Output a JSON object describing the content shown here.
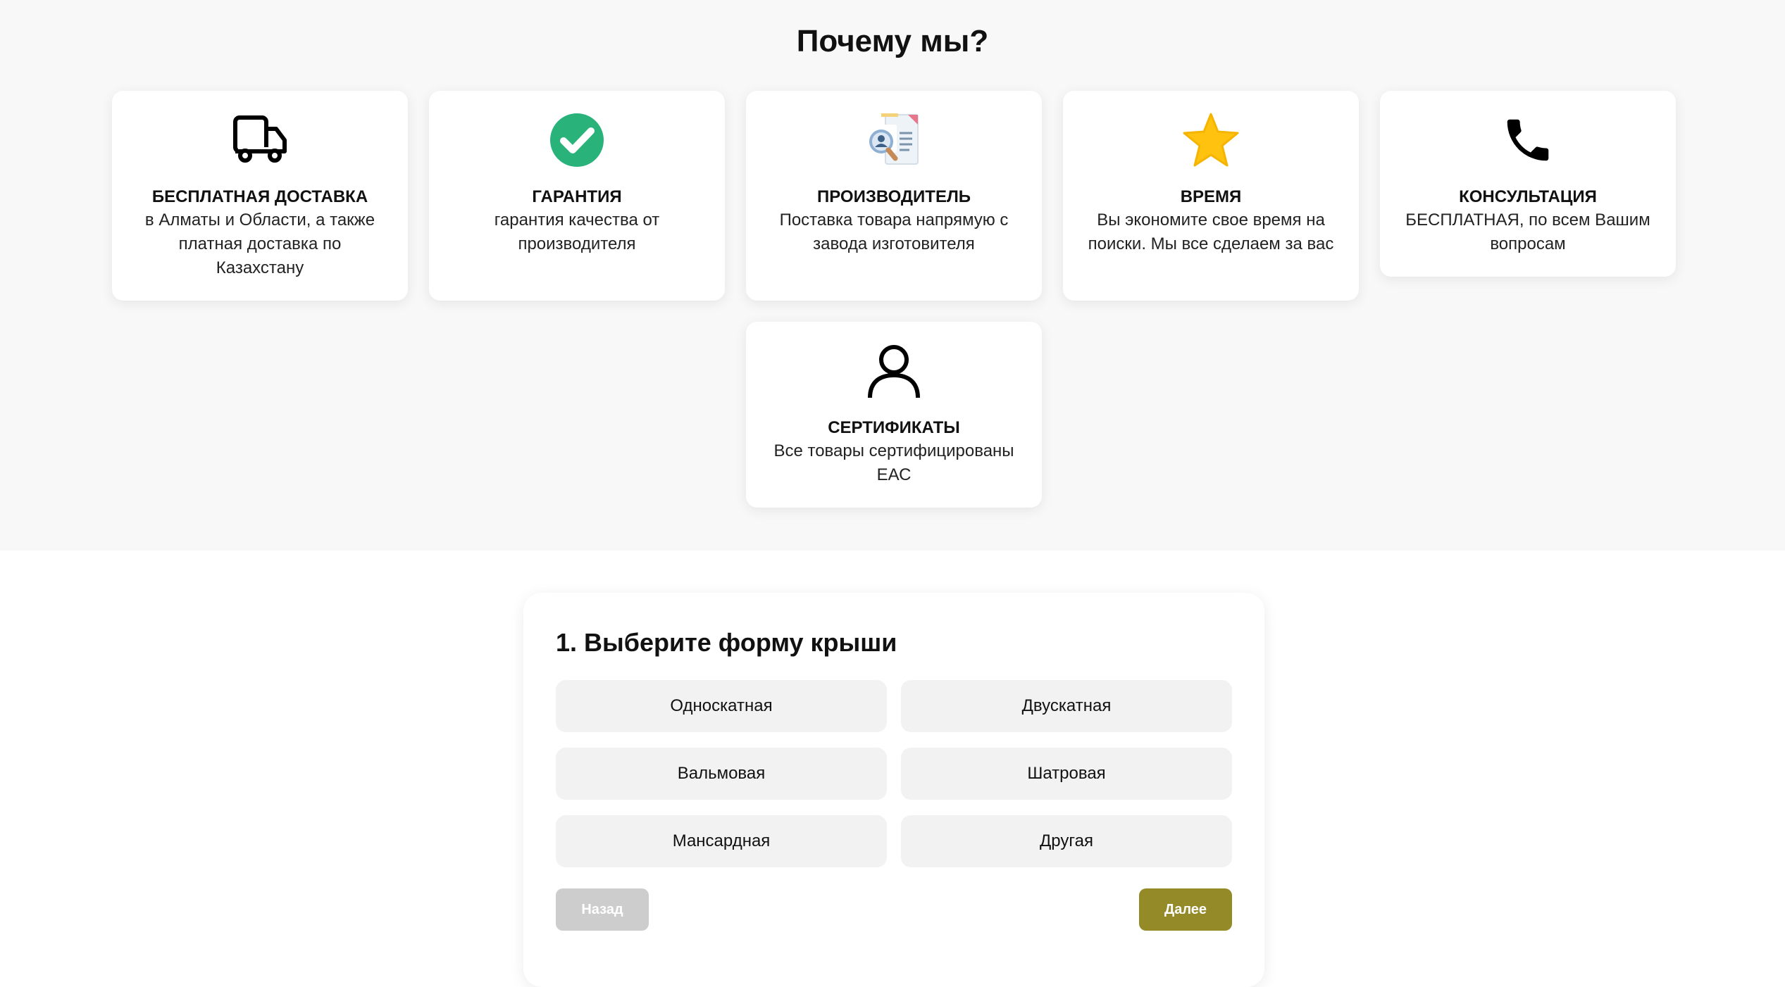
{
  "why_section": {
    "title": "Почему мы?",
    "cards": [
      {
        "icon": "truck-icon",
        "title": "БЕСПЛАТНАЯ ДОСТАВКА",
        "desc": "в Алматы и Области, а также платная доставка по Казахстану"
      },
      {
        "icon": "check-circle-icon",
        "title": "ГАРАНТИЯ",
        "desc": "гарантия качества от производителя"
      },
      {
        "icon": "document-search-icon",
        "title": "ПРОИЗВОДИТЕЛЬ",
        "desc": "Поставка товара напрямую с завода изготовителя"
      },
      {
        "icon": "star-icon",
        "title": "ВРЕМЯ",
        "desc": "Вы экономите свое время на поиски. Мы все сделаем за вас"
      },
      {
        "icon": "phone-icon",
        "title": "КОНСУЛЬТАЦИЯ",
        "desc": "БЕСПЛАТНАЯ, по всем Вашим вопросам"
      },
      {
        "icon": "user-icon",
        "title": "СЕРТИФИКАТЫ",
        "desc": "Все товары сертифицированы ЕАС"
      }
    ]
  },
  "quiz": {
    "title": "1. Выберите форму крыши",
    "options": [
      "Односкатная",
      "Двускатная",
      "Вальмовая",
      "Шатровая",
      "Мансардная",
      "Другая"
    ],
    "back_label": "Назад",
    "next_label": "Далее"
  },
  "colors": {
    "section_bg": "#f8f8f8",
    "check_green": "#2ab27b",
    "star_yellow": "#ffc20e",
    "next_button": "#958a28",
    "back_button": "#cdcdcd"
  }
}
